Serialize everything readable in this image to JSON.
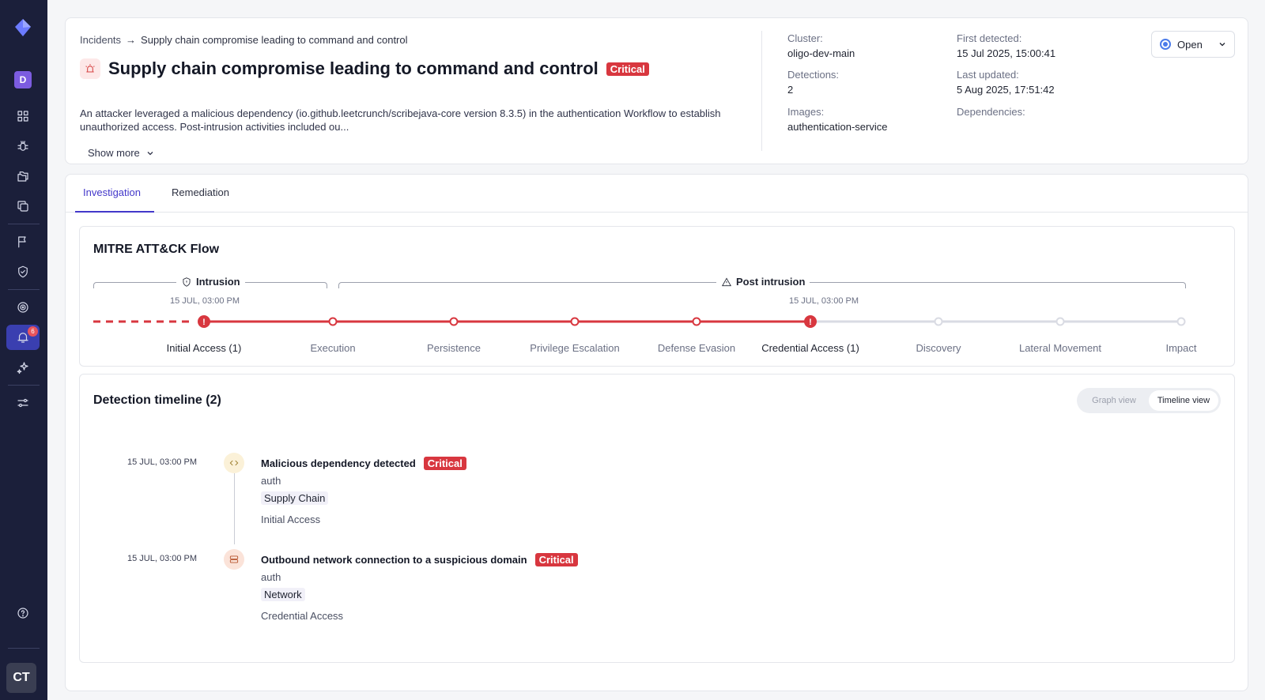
{
  "sidebar": {
    "org_initial": "D",
    "alerts_badge": "6",
    "avatar_initials": "CT",
    "icons": [
      "dashboard-icon",
      "bug-icon",
      "folders-icon",
      "copy-icon",
      "flag-icon",
      "shield-icon",
      "target-icon",
      "bell-icon",
      "sparkle-icon",
      "sliders-icon",
      "help-icon"
    ]
  },
  "header": {
    "breadcrumb": {
      "parent": "Incidents",
      "separator": "→",
      "current": "Supply chain compromise leading to command and control"
    },
    "title": "Supply chain compromise leading to command and control",
    "severity": "Critical",
    "description": "An attacker leveraged a malicious dependency (io.github.leetcrunch/scribejava-core version 8.3.5) in the authentication Workflow to establish unauthorized access. Post-intrusion activities included ou...",
    "show_more": "Show more",
    "meta": {
      "cluster_label": "Cluster:",
      "cluster_value": "oligo-dev-main",
      "detections_label": "Detections:",
      "detections_value": "2",
      "images_label": "Images:",
      "images_value": "authentication-service",
      "first_detected_label": "First detected:",
      "first_detected_value": "15 Jul 2025, 15:00:41",
      "last_updated_label": "Last updated:",
      "last_updated_value": "5 Aug 2025, 17:51:42",
      "dependencies_label": "Dependencies:"
    },
    "status": "Open",
    "accent": "#4b7bea",
    "severity_color": "#d8373f"
  },
  "tabs": [
    {
      "label": "Investigation",
      "active": true
    },
    {
      "label": "Remediation",
      "active": false
    }
  ],
  "mitre": {
    "title": "MITRE ATT&CK Flow",
    "phases": {
      "intrusion": "Intrusion",
      "post_intrusion": "Post intrusion"
    },
    "times": {
      "intrusion": "15 JUL, 03:00 PM",
      "post_intrusion": "15 JUL, 03:00 PM"
    },
    "tactics": [
      {
        "label": "Initial Access (1)",
        "hit": true
      },
      {
        "label": "Execution",
        "hit": false
      },
      {
        "label": "Persistence",
        "hit": false
      },
      {
        "label": "Privilege Escalation",
        "hit": false
      },
      {
        "label": "Defense Evasion",
        "hit": false
      },
      {
        "label": "Credential Access (1)",
        "hit": true
      },
      {
        "label": "Discovery",
        "hit": false
      },
      {
        "label": "Lateral Movement",
        "hit": false
      },
      {
        "label": "Impact",
        "hit": false
      }
    ],
    "active_color": "#d8373f",
    "inactive_color": "#d9dbe3"
  },
  "timeline": {
    "title": "Detection timeline (2)",
    "views": {
      "graph": "Graph view",
      "timeline": "Timeline view"
    },
    "events": [
      {
        "time": "15 JUL, 03:00 PM",
        "title": "Malicious dependency detected",
        "severity": "Critical",
        "workload": "auth",
        "category": "Supply Chain",
        "tactic": "Initial Access",
        "icon": "code-icon"
      },
      {
        "time": "15 JUL, 03:00 PM",
        "title": "Outbound network connection to a suspicious domain",
        "severity": "Critical",
        "workload": "auth",
        "category": "Network",
        "tactic": "Credential Access",
        "icon": "server-icon"
      }
    ]
  }
}
